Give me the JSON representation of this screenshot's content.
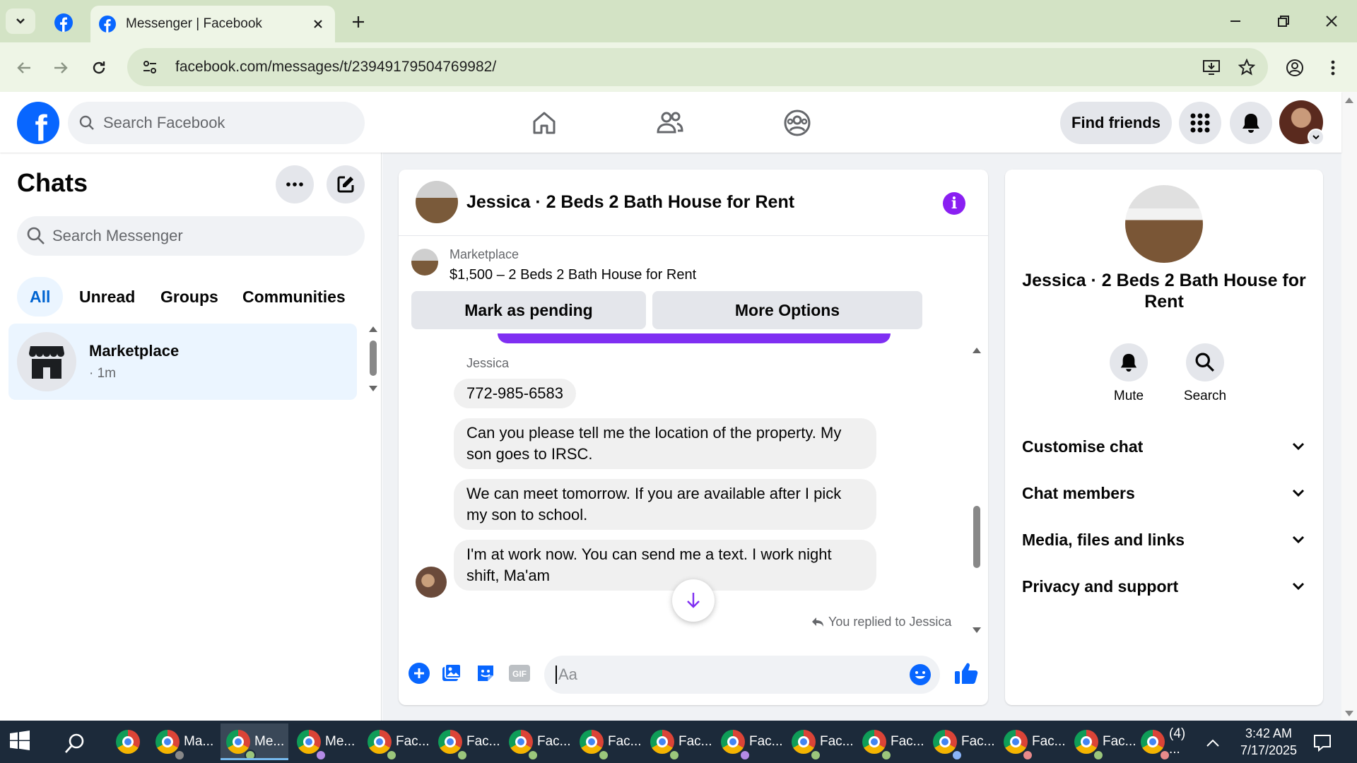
{
  "browser": {
    "tab_title": "Messenger | Facebook",
    "url": "facebook.com/messages/t/23949179504769982/"
  },
  "header": {
    "search_placeholder": "Search Facebook",
    "find_friends": "Find friends"
  },
  "chats": {
    "title": "Chats",
    "search_placeholder": "Search Messenger",
    "filters": [
      "All",
      "Unread",
      "Groups",
      "Communities"
    ],
    "active_filter": "All",
    "items": [
      {
        "name": "Marketplace",
        "time": "· 1m"
      }
    ]
  },
  "conversation": {
    "title": "Jessica · 2 Beds 2 Bath House for Rent",
    "marketplace_label": "Marketplace",
    "listing": "$1,500 – 2 Beds 2 Bath House for Rent",
    "mark_pending": "Mark as pending",
    "more_options": "More Options",
    "sender": "Jessica",
    "messages": [
      "772-985-6583",
      "Can you please tell me the location of the property. My son goes to IRSC.",
      "We can meet tomorrow. If you are available after I pick my son to school.",
      "I'm at work now. You can send me a text. I work night shift, Ma'am"
    ],
    "replied_note": "You replied to Jessica",
    "composer_placeholder": "Aa"
  },
  "info_panel": {
    "name": "Jessica · 2 Beds 2 Bath House for Rent",
    "actions": [
      "Mute",
      "Search"
    ],
    "sections": [
      "Customise chat",
      "Chat members",
      "Media, files and links",
      "Privacy and support"
    ]
  },
  "taskbar": {
    "items": [
      "Ma...",
      "Me...",
      "Me...",
      "Fac...",
      "Fac...",
      "Fac...",
      "Fac...",
      "Fac...",
      "Fac...",
      "Fac...",
      "Fac...",
      "Fac...",
      "Fac...",
      "Fac...",
      "(4) ..."
    ],
    "time": "3:42 AM",
    "date": "7/17/2025"
  },
  "colors": {
    "facebook_blue": "#0866ff",
    "active_chat_bg": "#ebf5ff",
    "messenger_purple": "#8a1ff2",
    "like_blue": "#0866ff"
  }
}
